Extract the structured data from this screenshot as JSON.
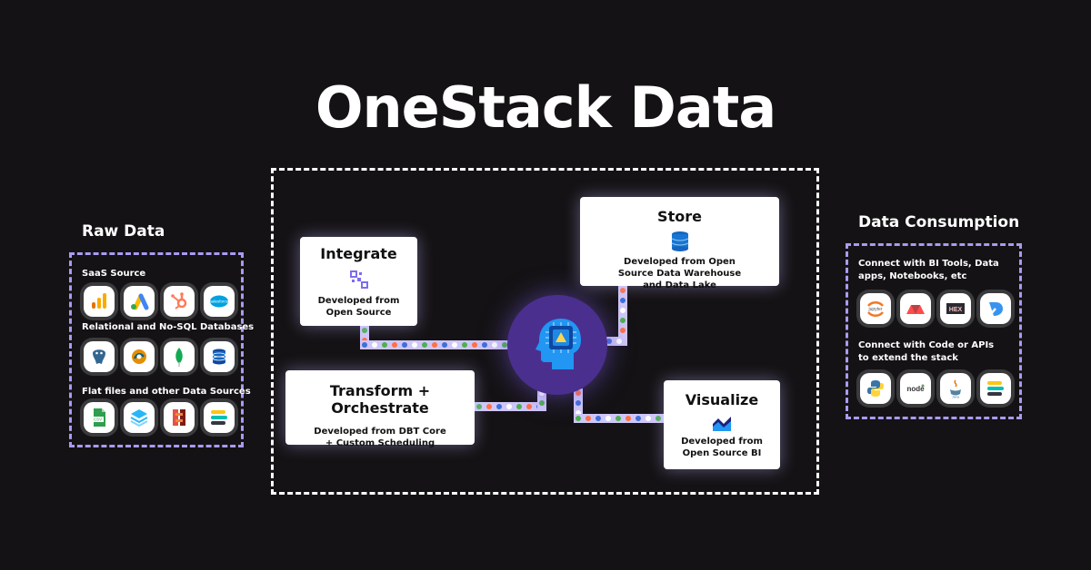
{
  "title": "OneStack Data",
  "raw_data": {
    "heading": "Raw Data",
    "groups": [
      {
        "label": "SaaS Source",
        "icons": [
          "google-analytics-icon",
          "google-ads-icon",
          "hubspot-icon",
          "salesforce-icon"
        ]
      },
      {
        "label": "Relational and No-SQL Databases",
        "icons": [
          "postgresql-icon",
          "mysql-icon",
          "mongodb-icon",
          "database-icon"
        ]
      },
      {
        "label": "Flat files and other Data Sources",
        "icons": [
          "csv-file-icon",
          "api-stream-icon",
          "aws-s3-icon",
          "elastic-icon"
        ]
      }
    ]
  },
  "consumption": {
    "heading": "Data Consumption",
    "groups": [
      {
        "label": "Connect with BI Tools, Data apps, Notebooks, etc",
        "icons": [
          "jupyter-icon",
          "streamlit-icon",
          "hex-icon",
          "deepnote-icon"
        ]
      },
      {
        "label": "Connect with Code or APIs to extend the stack",
        "icons": [
          "python-icon",
          "nodejs-icon",
          "java-icon",
          "elastic-icon"
        ]
      }
    ]
  },
  "cards": {
    "integrate": {
      "title": "Integrate",
      "desc": "Developed from Open Source"
    },
    "store": {
      "title": "Store",
      "desc": "Developed from Open Source Data Warehouse and Data Lake"
    },
    "transform": {
      "title": "Transform + Orchestrate",
      "desc": "Developed from DBT Core + Custom Scheduling"
    },
    "visualize": {
      "title": "Visualize",
      "desc": "Developed from Open Source BI"
    }
  },
  "colors": {
    "background": "#141214",
    "accent_purple": "#a99bf1",
    "hub": "#4a2f8e",
    "head": "#2196f3",
    "bead_colors": [
      "#4caf50",
      "#ff7043",
      "#3f6fd8",
      "#ffffff"
    ]
  }
}
